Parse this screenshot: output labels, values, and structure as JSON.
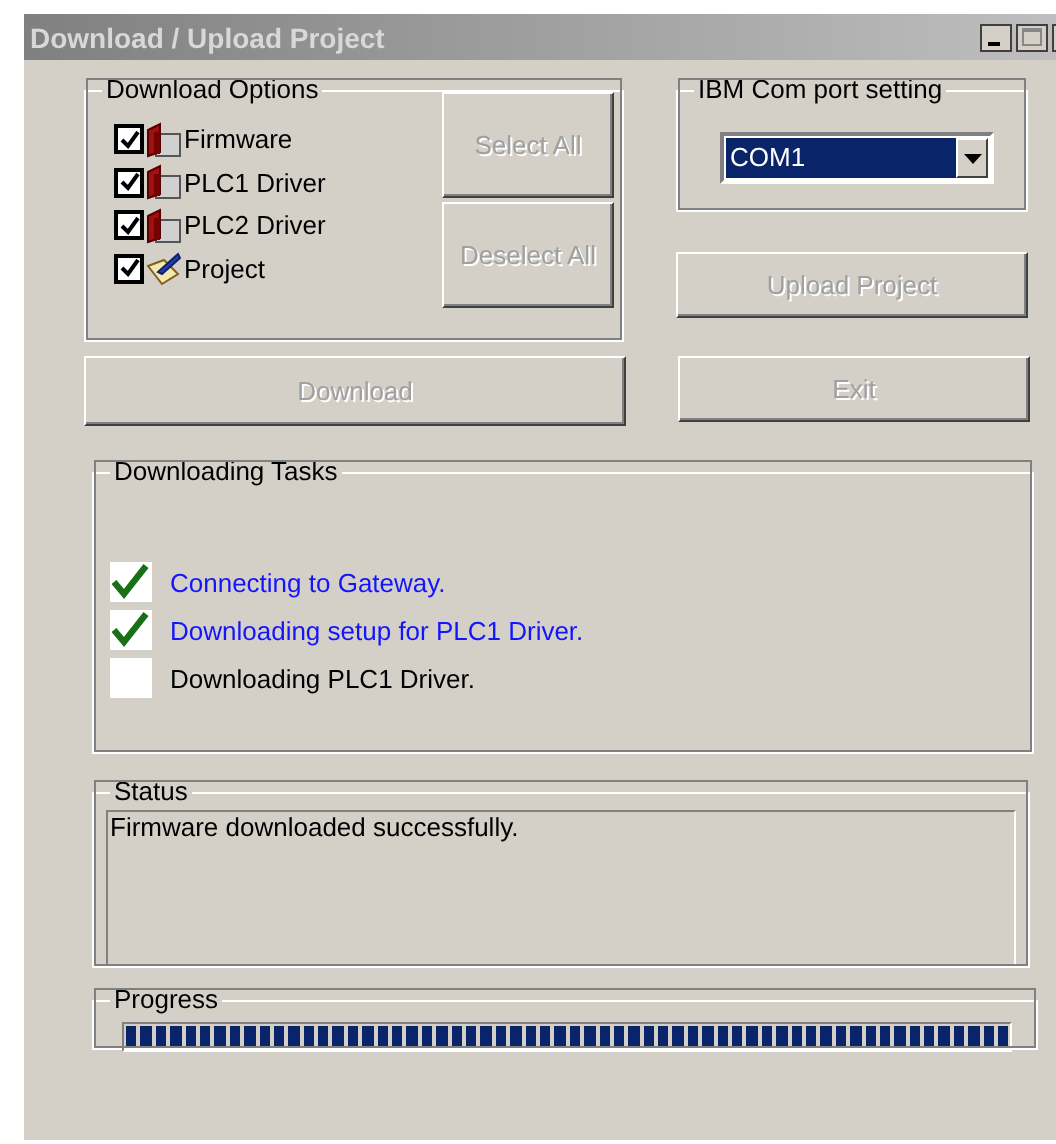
{
  "window": {
    "title": "Download / Upload Project"
  },
  "download_options": {
    "title": "Download Options",
    "items": [
      {
        "label": "Firmware",
        "kind": "driver",
        "checked": true
      },
      {
        "label": "PLC1 Driver",
        "kind": "driver",
        "checked": true
      },
      {
        "label": "PLC2 Driver",
        "kind": "driver",
        "checked": true
      },
      {
        "label": "Project",
        "kind": "project",
        "checked": true
      }
    ],
    "buttons": [
      {
        "label": "Select All",
        "disabled": true
      },
      {
        "label": "Deselect All",
        "disabled": true
      }
    ]
  },
  "com_port": {
    "title": "IBM Com port setting",
    "value": "COM1"
  },
  "upload_button": {
    "label": "Upload Project",
    "disabled": true
  },
  "download_button": {
    "label": "Download",
    "disabled": true
  },
  "exit_button": {
    "label": "Exit",
    "disabled": true
  },
  "tasks": {
    "title": "Downloading Tasks",
    "items": [
      {
        "label": "Connecting to Gateway.",
        "done": true
      },
      {
        "label": "Downloading setup for PLC1 Driver.",
        "done": true
      },
      {
        "label": "Downloading PLC1 Driver.",
        "done": false
      }
    ]
  },
  "status": {
    "title": "Status",
    "text": "Firmware downloaded successfully."
  },
  "progress": {
    "title": "Progress",
    "level": 1
  }
}
